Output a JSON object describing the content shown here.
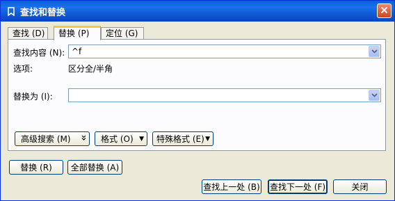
{
  "window": {
    "title": "查找和替换"
  },
  "tabs": [
    {
      "label": "查找 (D)"
    },
    {
      "label": "替换 (P)"
    },
    {
      "label": "定位 (G)"
    }
  ],
  "find": {
    "label": "查找内容 (N):",
    "value": "^f"
  },
  "options": {
    "label": "选项:",
    "value": "区分全/半角"
  },
  "replace": {
    "label": "替换为 (I):",
    "value": ""
  },
  "panel_buttons": {
    "advanced": "高级搜索 (M)",
    "advanced_icon": "double-chevron-down",
    "format": "格式 (O)",
    "special": "特殊格式 (E)"
  },
  "action_buttons": {
    "replace": "替换 (R)",
    "replace_all": "全部替换 (A)",
    "find_prev": "查找上一处 (B)",
    "find_next": "查找下一处 (F)",
    "close": "关闭"
  }
}
